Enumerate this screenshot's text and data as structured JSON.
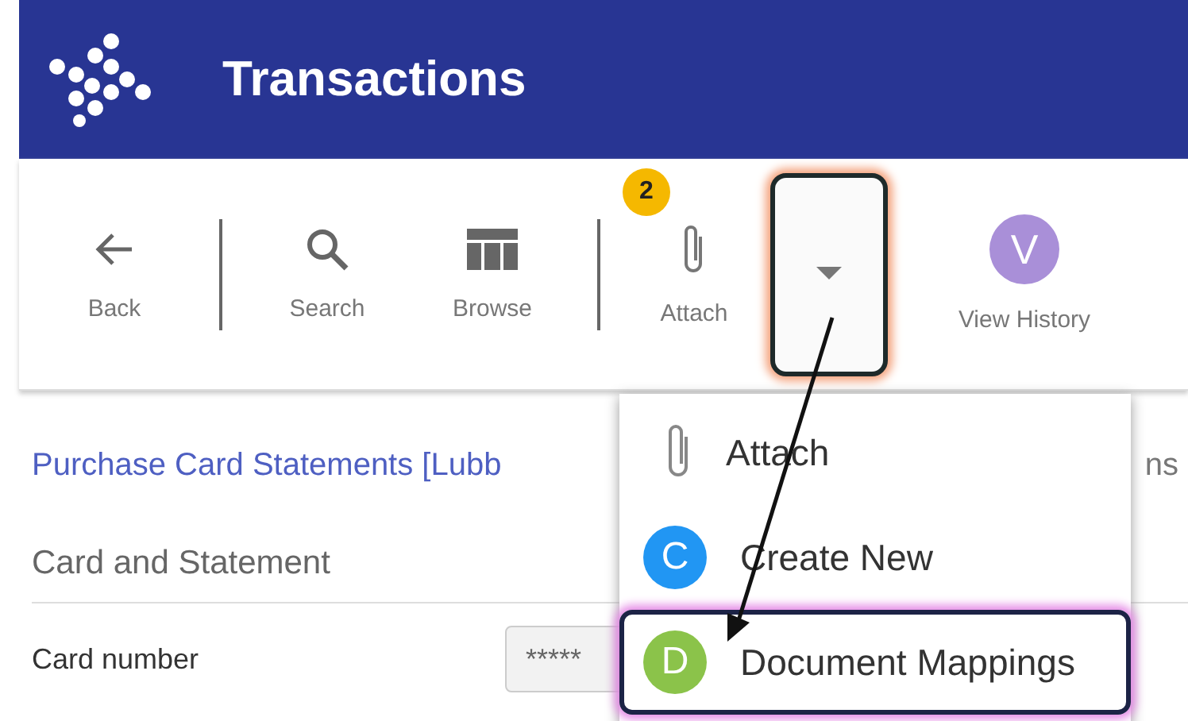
{
  "header": {
    "title": "Transactions"
  },
  "toolbar": [
    {
      "kind": "button",
      "label": "Back"
    },
    {
      "kind": "separator"
    },
    {
      "kind": "button",
      "label": "Search"
    },
    {
      "kind": "button",
      "label": "Browse"
    },
    {
      "kind": "separator"
    },
    {
      "kind": "badged",
      "label": "Attach",
      "badge": "2"
    },
    {
      "kind": "toggle",
      "expanded": true
    },
    {
      "kind": "avatar",
      "letter": "V",
      "label": "View History",
      "color": "#a98fd8"
    }
  ],
  "content": {
    "link": "Purchase Card Statements [Lubb",
    "link_tail": "ns",
    "section": "Card and Statement",
    "fields": [
      {
        "label": "Card number",
        "value": "*****"
      }
    ]
  },
  "menu": [
    {
      "kind": "icon",
      "label": "Attach",
      "selected": false
    },
    {
      "kind": "avatar",
      "letter": "C",
      "label": "Create New",
      "color": "#2196f3",
      "selected": false
    },
    {
      "kind": "avatar",
      "letter": "D",
      "label": "Document Mappings",
      "color": "#8bc34a",
      "selected": true
    }
  ]
}
